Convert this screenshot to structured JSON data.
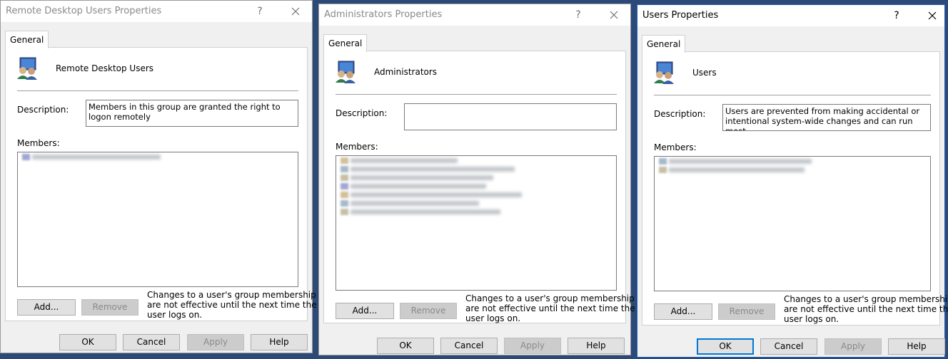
{
  "dialogs": [
    {
      "title": "Remote Desktop Users Properties",
      "help_glyph": "?",
      "tab": "General",
      "group_name": "Remote Desktop Users",
      "description_label": "Description:",
      "description_value": "Members in this group are granted the right to logon remotely",
      "members_label": "Members:",
      "members_visible_count": 1,
      "add_button": "Add...",
      "remove_button": "Remove",
      "note": [
        "Changes to a user's group membership",
        "are not effective until the next time the",
        "user logs on."
      ],
      "ok_button": "OK",
      "cancel_button": "Cancel",
      "apply_button": "Apply",
      "help_button": "Help"
    },
    {
      "title": "Administrators Properties",
      "help_glyph": "?",
      "tab": "General",
      "group_name": "Administrators",
      "description_label": "Description:",
      "description_value": "",
      "members_label": "Members:",
      "members_visible_count": 7,
      "add_button": "Add...",
      "remove_button": "Remove",
      "note": [
        "Changes to a user's group membership",
        "are not effective until the next time the",
        "user logs on."
      ],
      "ok_button": "OK",
      "cancel_button": "Cancel",
      "apply_button": "Apply",
      "help_button": "Help"
    },
    {
      "title": "Users Properties",
      "help_glyph": "?",
      "tab": "General",
      "group_name": "Users",
      "description_label": "Description:",
      "description_value": "Users are prevented from making accidental or intentional system-wide changes and can run most",
      "members_label": "Members:",
      "members_visible_count": 2,
      "add_button": "Add...",
      "remove_button": "Remove",
      "note": [
        "Changes to a user's group membership",
        "are not effective until the next time the",
        "user logs on."
      ],
      "ok_button": "OK",
      "cancel_button": "Cancel",
      "apply_button": "Apply",
      "help_button": "Help"
    }
  ],
  "icons": {
    "group": "group-users-icon",
    "close": "close-icon",
    "help": "help-icon",
    "member": "member-user-icon"
  },
  "colors": {
    "window_bg": "#f0f0f0",
    "focus_border": "#0078d7",
    "desktop_bg": "#2b4a78"
  }
}
